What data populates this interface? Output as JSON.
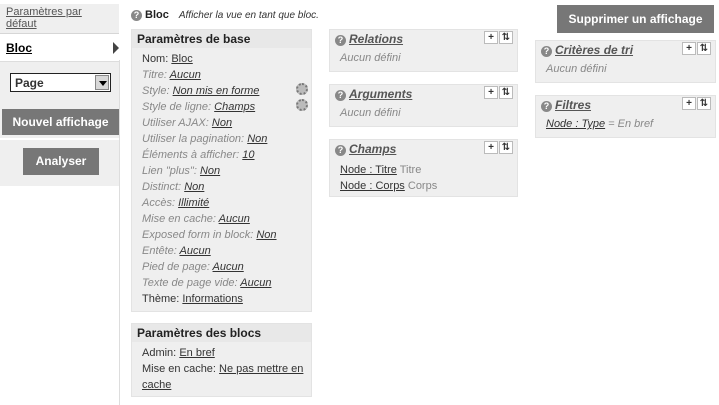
{
  "left": {
    "tab_default": "Paramètres par défaut",
    "tab_bloc": "Bloc",
    "display_type": "Page",
    "new_display": "Nouvel affichage",
    "analyse": "Analyser"
  },
  "header": {
    "icon": "?",
    "title": "Bloc",
    "desc": "Afficher la vue en tant que bloc.",
    "delete": "Supprimer un affichage"
  },
  "basic": {
    "title": "Paramètres de base",
    "rows": [
      {
        "label": "Nom:",
        "value": "Bloc",
        "muted": false
      },
      {
        "label": "Titre:",
        "value": "Aucun",
        "muted": true
      },
      {
        "label": "Style:",
        "value": "Non mis en forme",
        "muted": true
      },
      {
        "label": "Style de ligne:",
        "value": "Champs",
        "muted": true
      },
      {
        "label": "Utiliser AJAX:",
        "value": "Non",
        "muted": true
      },
      {
        "label": "Utiliser la pagination:",
        "value": "Non",
        "muted": true
      },
      {
        "label": "Éléments à afficher:",
        "value": "10",
        "muted": true
      },
      {
        "label": "Lien \"plus\":",
        "value": "Non",
        "muted": true
      },
      {
        "label": "Distinct:",
        "value": "Non",
        "muted": true
      },
      {
        "label": "Accès:",
        "value": "Illimité",
        "muted": true
      },
      {
        "label": "Mise en cache:",
        "value": "Aucun",
        "muted": true
      },
      {
        "label": "Exposed form in block:",
        "value": "Non",
        "muted": true
      },
      {
        "label": "Entête:",
        "value": "Aucun",
        "muted": true
      },
      {
        "label": "Pied de page:",
        "value": "Aucun",
        "muted": true
      },
      {
        "label": "Texte de page vide:",
        "value": "Aucun",
        "muted": true
      },
      {
        "label": "Thème:",
        "value": "Informations",
        "muted": false
      }
    ]
  },
  "blocks": {
    "title": "Paramètres des blocs",
    "admin_label": "Admin:",
    "admin_value": "En bref",
    "cache_label": "Mise en cache:",
    "cache_value_1": "Ne pas mettre en",
    "cache_value_2": "cache"
  },
  "relations": {
    "title": "Relations",
    "body": "Aucun défini"
  },
  "arguments": {
    "title": "Arguments",
    "body": "Aucun défini"
  },
  "fields": {
    "title": "Champs",
    "items": [
      {
        "link": "Node : Titre",
        "label": "Titre"
      },
      {
        "link": "Node : Corps",
        "label": "Corps"
      }
    ]
  },
  "sort": {
    "title": "Critères de tri",
    "body": "Aucun défini"
  },
  "filters": {
    "title": "Filtres",
    "link": "Node : Type",
    "value": "= En bref"
  },
  "icons": {
    "help": "question-icon",
    "add": "plus-icon",
    "rearrange": "up-down-arrows-icon",
    "settings": "gear-icon"
  }
}
